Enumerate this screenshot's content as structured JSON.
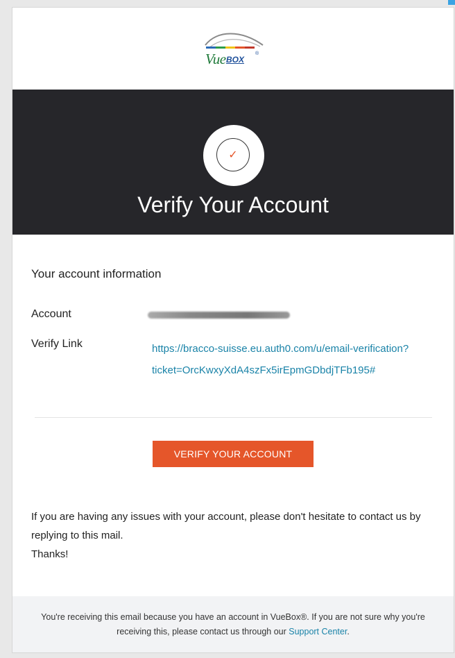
{
  "brand": {
    "logo_text": "Vue",
    "logo_box_text": "BOX",
    "logo_registered": "®",
    "accent_color": "#e5562a",
    "dark_color": "#26262a"
  },
  "hero": {
    "icon": "checkmark-circle-icon",
    "title": "Verify Your Account"
  },
  "account_info": {
    "section_title": "Your account information",
    "account_label": "Account",
    "account_value_redacted": true,
    "verify_link_label": "Verify Link",
    "verify_link_url": "https://bracco-suisse.eu.auth0.com/u/email-verification?ticket=OrcKwxyXdA4szFx5irEpmGDbdjTFb195#"
  },
  "cta": {
    "button_label": "VERIFY YOUR ACCOUNT"
  },
  "message": {
    "line1": "If you are having any issues with your account, please don't hesitate to contact us by replying to this mail.",
    "thanks": "Thanks!"
  },
  "footer": {
    "text_before": "You're receiving this email because you have an account in VueBox®. If you are not sure why you're receiving this, please contact us through our",
    "link_text": "Support Center",
    "text_after": "."
  }
}
